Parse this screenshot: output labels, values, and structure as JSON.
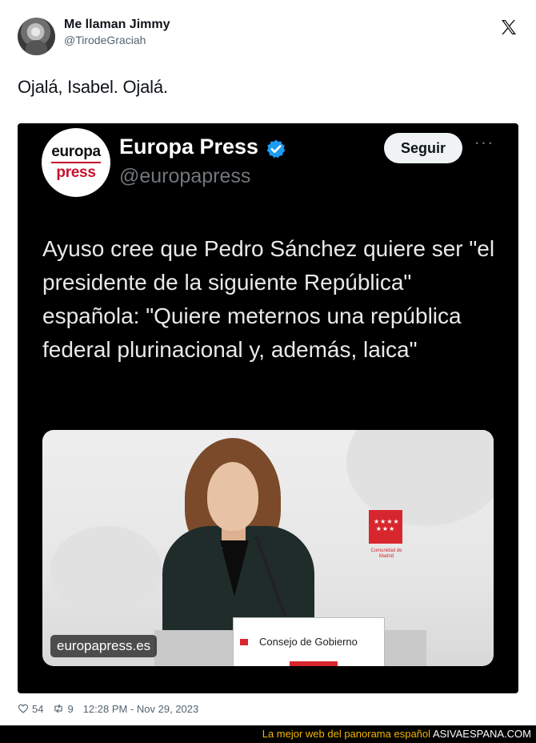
{
  "tweet": {
    "author_name": "Me llaman Jimmy",
    "author_handle": "@TirodeGraciah",
    "text": "Ojalá, Isabel. Ojalá.",
    "likes": "54",
    "retweets": "9",
    "timestamp": "12:28 PM - Nov 29, 2023",
    "platform_icon": "x-logo-icon"
  },
  "embedded": {
    "logo_line1": "europa",
    "logo_line2": "press",
    "account_name": "Europa Press",
    "account_handle": "@europapress",
    "follow_label": "Seguir",
    "more_label": "···",
    "headline": "Ayuso cree que Pedro Sánchez quiere ser \"el presidente de la siguiente República\" española: \"Quiere meternos una república federal plurinacional y, además, laica\"",
    "photo": {
      "watermark": "europapress.es",
      "podium_label": "Consejo de Gobierno",
      "regional_logo_text": "Comunidad de Madrid"
    }
  },
  "banner": {
    "text": "La mejor web del panorama español",
    "site": "ASIVAESPANA.COM"
  },
  "colors": {
    "brand_red": "#c8102e",
    "verified_blue": "#1d9bf0",
    "banner_accent": "#f2b705"
  }
}
